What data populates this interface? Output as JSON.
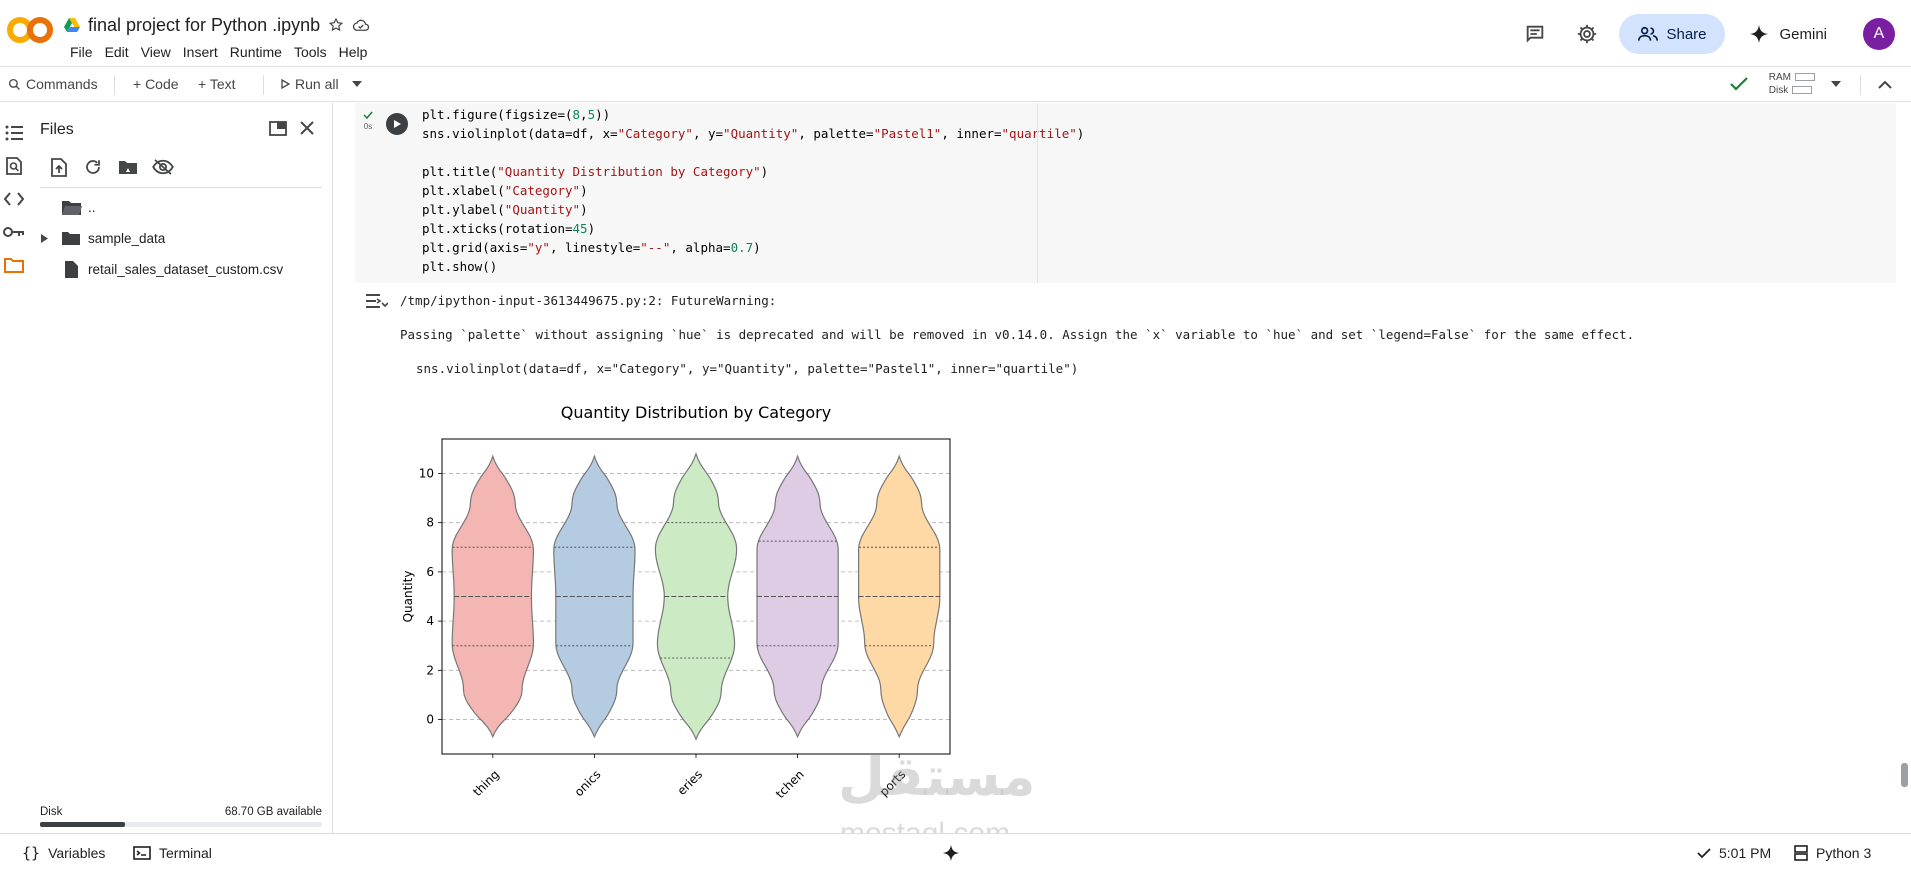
{
  "app": {
    "notebook_title": "final project for Python .ipynb",
    "menu": [
      "File",
      "Edit",
      "View",
      "Insert",
      "Runtime",
      "Tools",
      "Help"
    ],
    "share_label": "Share",
    "gemini_label": "Gemini",
    "avatar_letter": "A"
  },
  "toolbar": {
    "commands_label": "Commands",
    "code_label": "+ Code",
    "text_label": "+ Text",
    "run_all_label": "Run all",
    "ram_label": "RAM",
    "disk_label": "Disk"
  },
  "files": {
    "title": "Files",
    "tree": [
      {
        "name": "..",
        "type": "folder-open"
      },
      {
        "name": "sample_data",
        "type": "folder"
      },
      {
        "name": "retail_sales_dataset_custom.csv",
        "type": "file"
      }
    ],
    "disk_label": "Disk",
    "disk_available": "68.70 GB available",
    "disk_used_fraction": 0.3
  },
  "cell": {
    "exec_time": "0s",
    "code_lines": [
      "plt.figure(figsize=(8,5))",
      "sns.violinplot(data=df, x=\"Category\", y=\"Quantity\", palette=\"Pastel1\", inner=\"quartile\")",
      "",
      "plt.title(\"Quantity Distribution by Category\")",
      "plt.xlabel(\"Category\")",
      "plt.ylabel(\"Quantity\")",
      "plt.xticks(rotation=45)",
      "plt.grid(axis=\"y\", linestyle=\"--\", alpha=0.7)",
      "plt.show()"
    ],
    "warning_line": "/tmp/ipython-input-3613449675.py:2: FutureWarning:",
    "warning_message": "Passing `palette` without assigning `hue` is deprecated and will be removed in v0.14.0. Assign the `x` variable to `hue` and set `legend=False` for the same effect.",
    "warning_code": "sns.violinplot(data=df, x=\"Category\", y=\"Quantity\", palette=\"Pastel1\", inner=\"quartile\")"
  },
  "chart_data": {
    "type": "violin",
    "title": "Quantity Distribution by Category",
    "ylabel": "Quantity",
    "xlabel": "",
    "ylim": [
      -1.4,
      11.4
    ],
    "yticks": [
      0,
      2,
      4,
      6,
      8,
      10
    ],
    "grid": "y-dashed",
    "categories": [
      "thing",
      "onics",
      "eries",
      "tchen",
      "ports"
    ],
    "colors": [
      "#f4b6b2",
      "#b4cbe2",
      "#ccebc5",
      "#decbe4",
      "#fed9a6"
    ],
    "violins": [
      {
        "min": -0.7,
        "max": 10.7,
        "q1": 3.0,
        "median": 5.0,
        "q3": 7.0
      },
      {
        "min": -0.7,
        "max": 10.7,
        "q1": 3.0,
        "median": 5.0,
        "q3": 7.0
      },
      {
        "min": -0.8,
        "max": 10.8,
        "q1": 2.5,
        "median": 5.0,
        "q3": 8.0
      },
      {
        "min": -0.7,
        "max": 10.7,
        "q1": 3.0,
        "median": 5.0,
        "q3": 7.25
      },
      {
        "min": -0.7,
        "max": 10.7,
        "q1": 3.0,
        "median": 5.0,
        "q3": 7.0
      }
    ]
  },
  "watermark": {
    "arabic": "مستقل",
    "latin": "mostaql.com"
  },
  "statusbar": {
    "variables_label": "Variables",
    "terminal_label": "Terminal",
    "time": "5:01 PM",
    "runtime": "Python 3"
  }
}
